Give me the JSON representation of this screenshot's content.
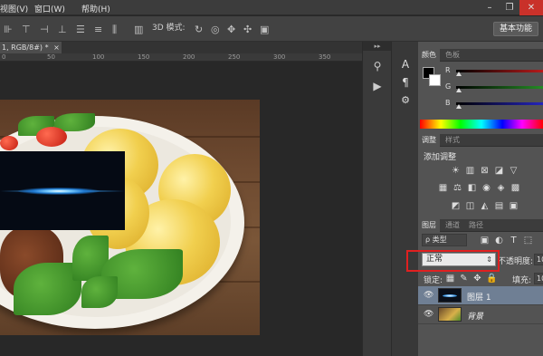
{
  "menu": [
    "视图(V)",
    "窗口(W)",
    "帮助(H)"
  ],
  "options_bar": {
    "mode_label": "3D 模式:",
    "workspace_button": "基本功能"
  },
  "document": {
    "tab_label": "1, RGB/8#) *",
    "tab_close": "×",
    "ruler_marks": [
      "0",
      "50",
      "100",
      "150",
      "200",
      "250",
      "300",
      "350"
    ]
  },
  "panels": {
    "color": {
      "tabs": [
        "颜色",
        "色板"
      ],
      "channels": [
        {
          "label": "R",
          "color": "#d11f1f",
          "value": 0
        },
        {
          "label": "G",
          "color": "#2aa12a",
          "value": 0
        },
        {
          "label": "B",
          "color": "#2a2ad8",
          "value": 0
        }
      ]
    },
    "adjustments": {
      "tabs": [
        "调整",
        "样式"
      ],
      "add_label": "添加调整"
    },
    "layers": {
      "tabs": [
        "图层",
        "通道",
        "路径"
      ],
      "filter_label": "ρ 类型",
      "blend_mode": "正常",
      "opacity_label": "不透明度:",
      "opacity_value": "10",
      "lock_label": "锁定:",
      "fill_label": "填充:",
      "fill_value": "10",
      "items": [
        {
          "name": "图层 1",
          "selected": true
        },
        {
          "name": "背景",
          "selected": false
        }
      ]
    }
  },
  "colors": {
    "highlight_outline": "#e02020",
    "selected_layer": "#6f7f94"
  }
}
